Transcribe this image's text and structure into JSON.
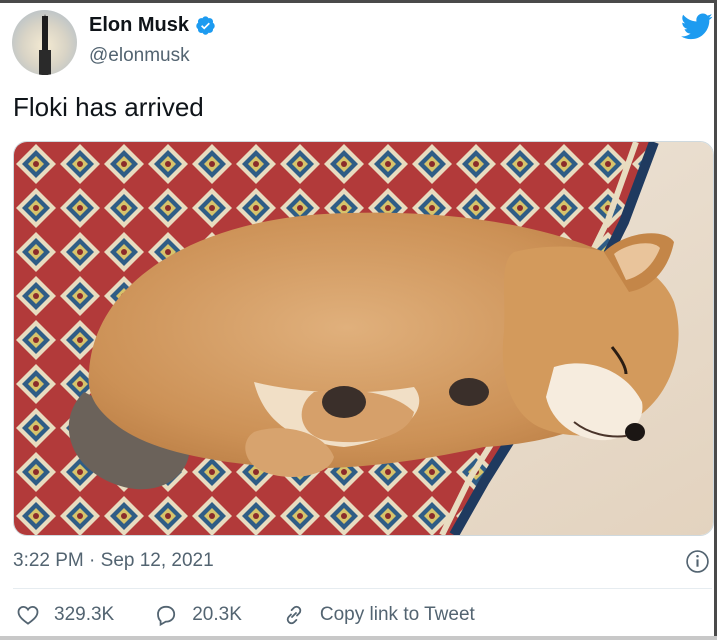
{
  "author": {
    "name": "Elon Musk",
    "handle": "@elonmusk",
    "avatar_icon": "starship-avatar",
    "verified_icon": "verified-badge-icon"
  },
  "tweet": {
    "text": "Floki has arrived",
    "media_icon": "shiba-inu-puppy-photo",
    "timestamp": "3:22 PM · Sep 12, 2021"
  },
  "actions": {
    "likes": "329.3K",
    "replies": "20.3K",
    "copy_link": "Copy link to Tweet"
  },
  "colors": {
    "twitter_blue": "#1d9bf0",
    "text": "#0f1419",
    "secondary": "#536471"
  }
}
